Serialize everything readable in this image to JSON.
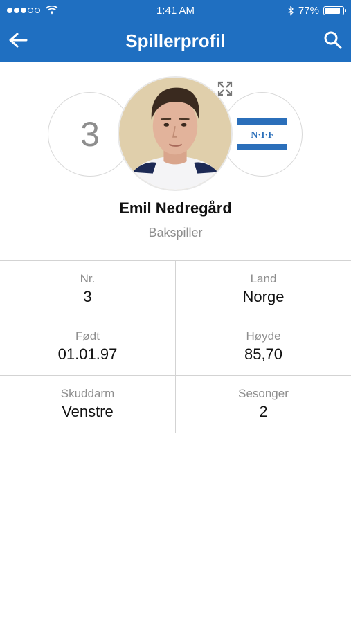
{
  "status_bar": {
    "time": "1:41 AM",
    "battery_text": "77%",
    "battery_level": 0.77,
    "signal_dots_filled": 3,
    "signal_dots_total": 5
  },
  "nav": {
    "title": "Spillerprofil",
    "back_icon": "arrow-left-icon",
    "search_icon": "search-icon"
  },
  "profile": {
    "number": "3",
    "name": "Emil Nedregård",
    "position": "Bakspiller",
    "club_logo_text": "N·I·F"
  },
  "stats": [
    {
      "left": {
        "label": "Nr.",
        "value": "3"
      },
      "right": {
        "label": "Land",
        "value": "Norge"
      }
    },
    {
      "left": {
        "label": "Født",
        "value": "01.01.97"
      },
      "right": {
        "label": "Høyde",
        "value": "85,70"
      }
    },
    {
      "left": {
        "label": "Skuddarm",
        "value": "Venstre"
      },
      "right": {
        "label": "Sesonger",
        "value": "2"
      }
    }
  ],
  "colors": {
    "brand_blue": "#1f6fc1",
    "muted_text": "#8e8e8e",
    "divider": "#d3d3d3"
  }
}
